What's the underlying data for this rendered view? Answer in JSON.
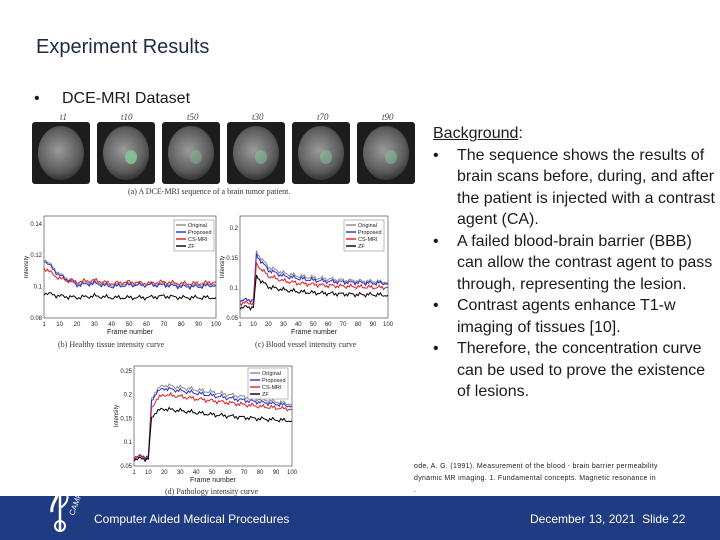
{
  "slide": {
    "title": "Experiment Results",
    "bullet_marker": "•",
    "bullet": "DCE-MRI Dataset"
  },
  "figure": {
    "frame_labels": [
      "t1",
      "t10",
      "t50",
      "t30",
      "t70",
      "t90"
    ],
    "caption_a": "(a) A DCE-MRI sequence of a brain tumor patient.",
    "caption_b": "(b) Healthy tissue intensity curve",
    "caption_c": "(c) Blood vessel intensity curve",
    "caption_d": "(d) Pathology intensity curve"
  },
  "colors": {
    "original": "#8c8c8c",
    "proposed": "#2b2bd6",
    "cs_mri": "#e02020",
    "zf": "#000000",
    "footer": "#1f3b82"
  },
  "chart_data": [
    {
      "type": "line",
      "id": "b",
      "xlabel": "Frame number",
      "ylabel": "Intensity",
      "xticks": [
        "1",
        "10",
        "20",
        "30",
        "40",
        "50",
        "60",
        "70",
        "80",
        "90",
        "100"
      ],
      "yticks": [
        "0.08",
        "0.1",
        "0.12",
        "0.14"
      ],
      "ylim": [
        0.08,
        0.145
      ],
      "legend": [
        "Original",
        "Proposed",
        "CS-MRI",
        "ZF"
      ],
      "series": [
        {
          "name": "Original",
          "values": [
            0.118,
            0.108,
            0.102,
            0.103,
            0.101,
            0.102,
            0.101,
            0.102,
            0.101,
            0.101,
            0.102
          ]
        },
        {
          "name": "Proposed",
          "values": [
            0.117,
            0.107,
            0.101,
            0.102,
            0.1,
            0.101,
            0.101,
            0.101,
            0.1,
            0.1,
            0.101
          ]
        },
        {
          "name": "CS-MRI",
          "values": [
            0.112,
            0.105,
            0.103,
            0.104,
            0.102,
            0.103,
            0.102,
            0.103,
            0.102,
            0.102,
            0.103
          ]
        },
        {
          "name": "ZF",
          "values": [
            0.096,
            0.094,
            0.093,
            0.094,
            0.093,
            0.093,
            0.093,
            0.094,
            0.093,
            0.093,
            0.093
          ]
        }
      ]
    },
    {
      "type": "line",
      "id": "c",
      "xlabel": "Frame number",
      "ylabel": "Intensity",
      "xticks": [
        "1",
        "10",
        "20",
        "30",
        "40",
        "50",
        "60",
        "70",
        "80",
        "90",
        "100"
      ],
      "yticks": [
        "0.05",
        "0.1",
        "0.15",
        "0.2"
      ],
      "ylim": [
        0.05,
        0.22
      ],
      "legend": [
        "Original",
        "Proposed",
        "CS-MRI",
        "ZF"
      ],
      "series": [
        {
          "name": "Original",
          "x": [
            1,
            10,
            12,
            15,
            20,
            30,
            40,
            50,
            60,
            70,
            80,
            90,
            100
          ],
          "values": [
            0.08,
            0.08,
            0.16,
            0.15,
            0.135,
            0.125,
            0.12,
            0.117,
            0.115,
            0.113,
            0.112,
            0.111,
            0.11
          ]
        },
        {
          "name": "Proposed",
          "x": [
            1,
            10,
            12,
            15,
            20,
            30,
            40,
            50,
            60,
            70,
            80,
            90,
            100
          ],
          "values": [
            0.08,
            0.08,
            0.155,
            0.145,
            0.13,
            0.12,
            0.116,
            0.113,
            0.111,
            0.11,
            0.109,
            0.108,
            0.108
          ]
        },
        {
          "name": "CS-MRI",
          "x": [
            1,
            10,
            12,
            15,
            20,
            30,
            40,
            50,
            60,
            70,
            80,
            90,
            100
          ],
          "values": [
            0.075,
            0.075,
            0.14,
            0.132,
            0.12,
            0.112,
            0.108,
            0.106,
            0.104,
            0.103,
            0.102,
            0.101,
            0.101
          ]
        },
        {
          "name": "ZF",
          "x": [
            1,
            10,
            12,
            15,
            20,
            30,
            40,
            50,
            60,
            70,
            80,
            90,
            100
          ],
          "values": [
            0.068,
            0.068,
            0.12,
            0.112,
            0.102,
            0.097,
            0.094,
            0.092,
            0.091,
            0.09,
            0.089,
            0.089,
            0.088
          ]
        }
      ]
    },
    {
      "type": "line",
      "id": "d",
      "xlabel": "Frame number",
      "ylabel": "Intensity",
      "xticks": [
        "1",
        "10",
        "20",
        "30",
        "40",
        "50",
        "60",
        "70",
        "80",
        "90",
        "100"
      ],
      "yticks": [
        "0.05",
        "0.1",
        "0.15",
        "0.2",
        "0.25"
      ],
      "ylim": [
        0.05,
        0.26
      ],
      "legend": [
        "Original",
        "Proposed",
        "CS-MRI",
        "ZF"
      ],
      "series": [
        {
          "name": "Original",
          "x": [
            1,
            10,
            12,
            15,
            20,
            30,
            40,
            50,
            60,
            70,
            80,
            90,
            100
          ],
          "values": [
            0.07,
            0.07,
            0.19,
            0.21,
            0.22,
            0.215,
            0.21,
            0.205,
            0.2,
            0.195,
            0.19,
            0.185,
            0.18
          ]
        },
        {
          "name": "Proposed",
          "x": [
            1,
            10,
            12,
            15,
            20,
            30,
            40,
            50,
            60,
            70,
            80,
            90,
            100
          ],
          "values": [
            0.07,
            0.07,
            0.185,
            0.205,
            0.213,
            0.208,
            0.203,
            0.198,
            0.193,
            0.188,
            0.184,
            0.18,
            0.176
          ]
        },
        {
          "name": "CS-MRI",
          "x": [
            1,
            10,
            12,
            15,
            20,
            30,
            40,
            50,
            60,
            70,
            80,
            90,
            100
          ],
          "values": [
            0.068,
            0.068,
            0.17,
            0.19,
            0.2,
            0.196,
            0.191,
            0.187,
            0.183,
            0.179,
            0.175,
            0.172,
            0.169
          ]
        },
        {
          "name": "ZF",
          "x": [
            1,
            10,
            12,
            15,
            20,
            30,
            40,
            50,
            60,
            70,
            80,
            90,
            100
          ],
          "values": [
            0.065,
            0.065,
            0.15,
            0.165,
            0.17,
            0.166,
            0.162,
            0.158,
            0.155,
            0.152,
            0.149,
            0.147,
            0.145
          ]
        }
      ]
    }
  ],
  "background": {
    "heading": "Background",
    "heading_colon": ":",
    "marker": "•",
    "bullets": [
      "The sequence shows the results of brain scans before, during, and after the patient is injected with a contrast agent (CA).",
      "A failed blood-brain barrier (BBB) can allow the contrast agent to pass through, representing the lesion.",
      "Contrast agents enhance T1-w imaging of tissues [10].",
      "Therefore, the concentration curve can be used to prove the existence of lesions."
    ]
  },
  "citation": {
    "line1": "ode, A. G. (1991). Measurement of the blood - brain barrier permeability",
    "line2": "dynamic MR imaging. 1. Fundamental concepts. Magnetic resonance in",
    "line3": "."
  },
  "footer": {
    "org": "Computer Aided Medical Procedures",
    "date": "December 13, 2021",
    "slide_label": "Slide 22",
    "logo_text": "CAMP"
  }
}
